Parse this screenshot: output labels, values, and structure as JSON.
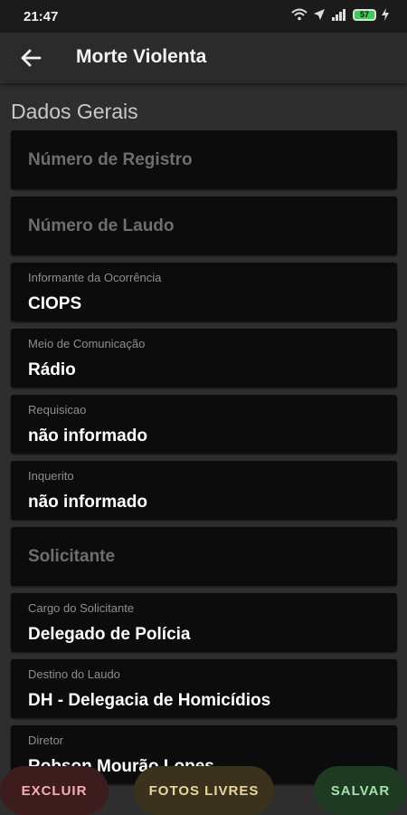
{
  "status": {
    "time": "21:47",
    "battery": "57"
  },
  "app_bar": {
    "title": "Morte Violenta"
  },
  "section": {
    "title": "Dados Gerais"
  },
  "fields": [
    {
      "placeholder": "Número de Registro"
    },
    {
      "placeholder": "Número de Laudo"
    },
    {
      "label": "Informante da Ocorrência",
      "value": "CIOPS"
    },
    {
      "label": "Meio de Comunicação",
      "value": "Rádio"
    },
    {
      "label": "Requisicao",
      "value": "não informado"
    },
    {
      "label": "Inquerito",
      "value": "não informado"
    },
    {
      "placeholder": "Solicitante"
    },
    {
      "label": "Cargo do Solicitante",
      "value": "Delegado de Polícia"
    },
    {
      "label": "Destino do Laudo",
      "value": "DH - Delegacia de Homicídios"
    },
    {
      "label": "Diretor",
      "value": "Robson Mourão Lopes"
    }
  ],
  "actions": {
    "delete": "EXCLUIR",
    "photos": "FOTOS LIVRES",
    "save": "SALVAR"
  },
  "colors": {
    "background": "#2e2e2e",
    "field": "#0c0c0c",
    "delete": "#3c1c1c",
    "photos": "#3a321c",
    "save": "#1e3a23"
  }
}
